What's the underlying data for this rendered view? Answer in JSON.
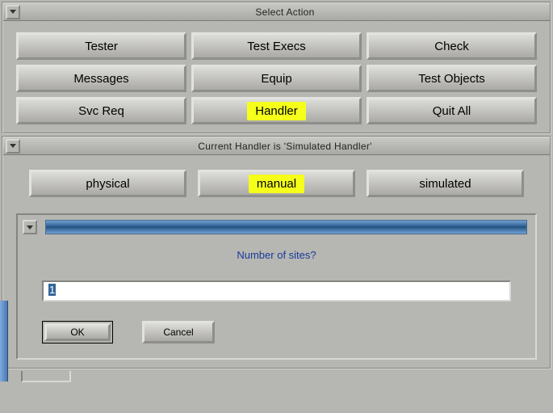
{
  "select_action": {
    "title": "Select Action",
    "buttons": {
      "tester": "Tester",
      "test_execs": "Test Execs",
      "check": "Check",
      "messages": "Messages",
      "equip": "Equip",
      "test_objects": "Test Objects",
      "svc_req": "Svc Req",
      "handler": "Handler",
      "quit_all": "Quit All"
    }
  },
  "handler_panel": {
    "title": "Current Handler is 'Simulated Handler'",
    "buttons": {
      "physical": "physical",
      "manual": "manual",
      "simulated": "simulated"
    }
  },
  "prompt_panel": {
    "prompt": "Number of sites?",
    "input_value": "1",
    "ok": "OK",
    "cancel": "Cancel"
  }
}
